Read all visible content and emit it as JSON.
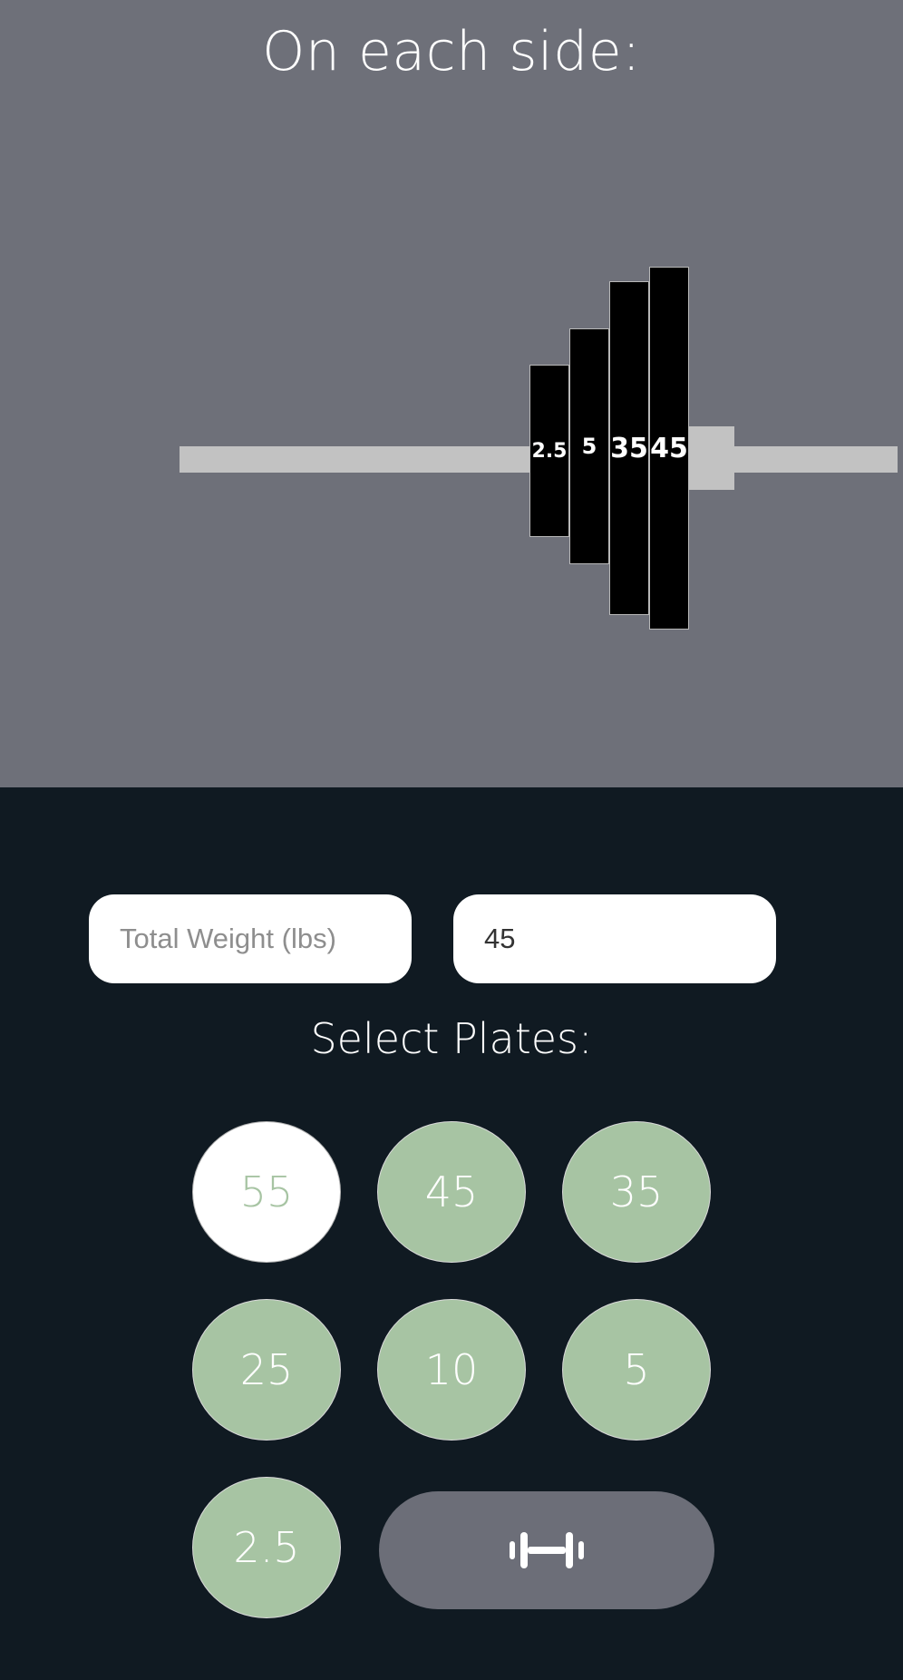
{
  "header": {
    "title": "On each side:"
  },
  "barbell": {
    "plates": [
      {
        "label": "2.5",
        "weight": 2.5
      },
      {
        "label": "5",
        "weight": 5
      },
      {
        "label": "35",
        "weight": 35
      },
      {
        "label": "45",
        "weight": 45
      }
    ]
  },
  "inputs": {
    "total_weight_placeholder": "Total Weight (lbs)",
    "total_weight_value": "",
    "bar_weight_value": "45"
  },
  "select": {
    "title": "Select Plates:",
    "plates": [
      {
        "label": "55",
        "selected": false
      },
      {
        "label": "45",
        "selected": true
      },
      {
        "label": "35",
        "selected": true
      },
      {
        "label": "25",
        "selected": true
      },
      {
        "label": "10",
        "selected": true
      },
      {
        "label": "5",
        "selected": true
      },
      {
        "label": "2.5",
        "selected": true
      }
    ]
  },
  "calculate_button": {
    "icon": "barbell-icon"
  },
  "colors": {
    "top_background": "#6e7079",
    "bottom_background": "#101a22",
    "plate_selected": "#a7c4a3",
    "plate_unselected": "#ffffff",
    "button": "#6c6e78"
  }
}
